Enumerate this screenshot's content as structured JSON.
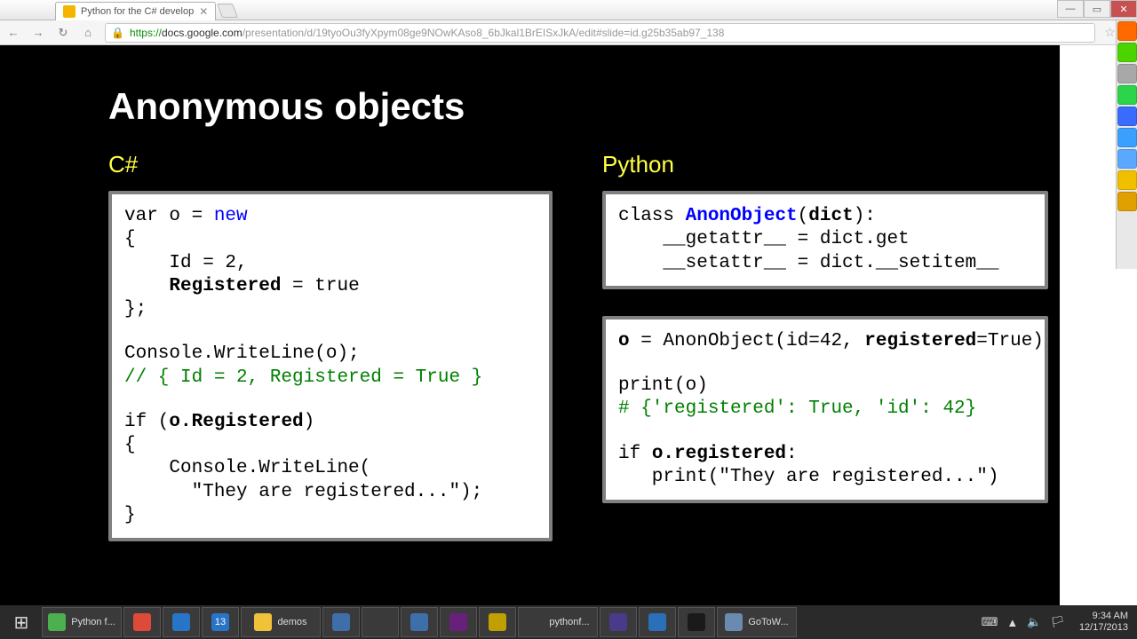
{
  "window": {
    "tab_title": "Python for the C# develop",
    "minimize": "—",
    "maximize": "▭",
    "close": "✕"
  },
  "toolbar": {
    "back": "←",
    "forward": "→",
    "reload": "↻",
    "home": "⌂",
    "lock": "🔒",
    "url_https": "https://",
    "url_host": "docs.google.com",
    "url_path": "/presentation/d/19tyoOu3fyXpym08ge9NOwKAso8_6bJkal1BrEISxJkA/edit#slide=id.g25b35ab97_138",
    "star": "☆",
    "menu": "≡"
  },
  "slide": {
    "title": "Anonymous objects",
    "left_label": "C#",
    "right_label": "Python",
    "csharp": {
      "l1a": "var o = ",
      "l1b": "new",
      "l2": "{",
      "l3": "    Id = 2,",
      "l4a": "    ",
      "l4b": "Registered",
      "l4c": " = true",
      "l5": "};",
      "l6": "Console.WriteLine(o);",
      "l7": "// { Id = 2, Registered = True }",
      "l8a": "if (",
      "l8b": "o.Registered",
      "l8c": ")",
      "l9": "{",
      "l10": "    Console.WriteLine(",
      "l11": "      \"They are registered...\");",
      "l12": "}"
    },
    "py1": {
      "a": "class ",
      "b": "AnonObject",
      "c": "(",
      "d": "dict",
      "e": "):",
      "l2": "    __getattr__ = dict.get",
      "l3": "    __setattr__ = dict.__setitem__"
    },
    "py2": {
      "l1a": "o",
      "l1b": " = AnonObject(id=42, ",
      "l1c": "registered",
      "l1d": "=True)",
      "l2": "print(o)",
      "l3": "# {'registered': True, 'id': 42}",
      "l4a": "if ",
      "l4b": "o.registered",
      "l4c": ":",
      "l5": "   print(\"They are registered...\")"
    }
  },
  "sidebar_colors": [
    "#ff6a00",
    "#4cd400",
    "#a8a8a8",
    "#2bd44b",
    "#3a6bff",
    "#3aa0ff",
    "#5aa8ff",
    "#f0c000",
    "#e0a000"
  ],
  "taskbar": {
    "start": "⊞",
    "items": [
      {
        "label": "Python f...",
        "bg": "#4caf50"
      },
      {
        "label": "",
        "bg": "#de4a3a"
      },
      {
        "label": "",
        "bg": "#2874c7"
      },
      {
        "label": "13",
        "bg": "#2874c7"
      },
      {
        "label": "demos",
        "bg": "#f0c23a"
      },
      {
        "label": "",
        "bg": "#3f6fa8"
      },
      {
        "label": "",
        "bg": "#3a3a3a"
      },
      {
        "label": "",
        "bg": "#3f6fa8"
      },
      {
        "label": "",
        "bg": "#68217a"
      },
      {
        "label": "",
        "bg": "#c0a000"
      },
      {
        "label": "pythonf...",
        "bg": "#3a3a3a"
      },
      {
        "label": "",
        "bg": "#4a3a8a"
      },
      {
        "label": "",
        "bg": "#2a6fb8"
      },
      {
        "label": "",
        "bg": "#1a1a1a"
      },
      {
        "label": "GoToW...",
        "bg": "#6a8ab0"
      }
    ]
  },
  "systray": {
    "icons": [
      "⌨",
      "▲",
      "🔈",
      "🏳"
    ],
    "time": "9:34 AM",
    "date": "12/17/2013"
  }
}
